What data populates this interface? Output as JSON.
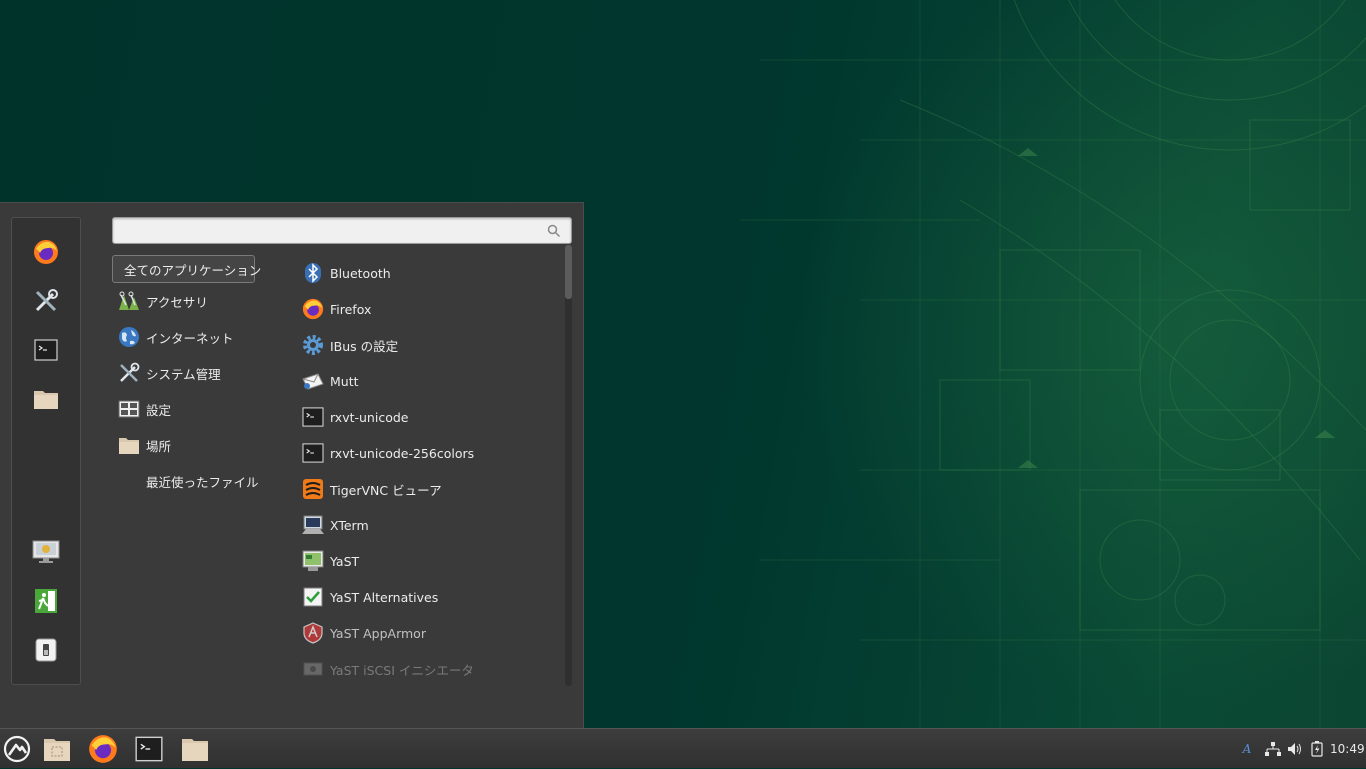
{
  "search": {
    "value": "",
    "placeholder": ""
  },
  "categories": [
    {
      "label": "全てのアプリケーション",
      "icon": "none",
      "selected": true
    },
    {
      "label": "アクセサリ",
      "icon": "accessories-icon"
    },
    {
      "label": "インターネット",
      "icon": "globe-icon"
    },
    {
      "label": "システム管理",
      "icon": "tools-icon"
    },
    {
      "label": "設定",
      "icon": "settings-icon"
    },
    {
      "label": "場所",
      "icon": "folder-icon"
    },
    {
      "label": "最近使ったファイル",
      "icon": "none"
    }
  ],
  "apps": [
    {
      "label": "Bluetooth",
      "icon": "bluetooth-icon"
    },
    {
      "label": "Firefox",
      "icon": "firefox-icon"
    },
    {
      "label": "IBus の設定",
      "icon": "gear-icon"
    },
    {
      "label": "Mutt",
      "icon": "mail-icon"
    },
    {
      "label": "rxvt-unicode",
      "icon": "terminal-icon"
    },
    {
      "label": "rxvt-unicode-256colors",
      "icon": "terminal-icon"
    },
    {
      "label": "TigerVNC ビューア",
      "icon": "tigervnc-icon"
    },
    {
      "label": "XTerm",
      "icon": "xterm-icon"
    },
    {
      "label": "YaST",
      "icon": "yast-icon"
    },
    {
      "label": "YaST Alternatives",
      "icon": "checkmark-icon"
    },
    {
      "label": "YaST AppArmor",
      "icon": "apparmor-shield-icon"
    },
    {
      "label": "YaST iSCSI イニシエータ",
      "icon": "iscsi-icon"
    }
  ],
  "favorites": [
    "firefox-icon",
    "tools-icon",
    "terminal-icon",
    "folder-icon"
  ],
  "session_buttons": [
    "lock-screen-icon",
    "logout-icon",
    "shutdown-icon"
  ],
  "taskbar": {
    "launchers": [
      "menu-logo-icon",
      "show-desktop-icon",
      "firefox-icon",
      "terminal-icon",
      "folder-icon"
    ],
    "tray": [
      "keyboard-layout-icon",
      "network-icon",
      "volume-icon",
      "battery-icon"
    ],
    "keyboard_layout": "A",
    "clock": "10:49"
  },
  "colors": {
    "desktop": "#00352c",
    "menu_bg": "#3a3a3a",
    "taskbar_bg": "#353535",
    "accent_green": "#5a9e55"
  }
}
